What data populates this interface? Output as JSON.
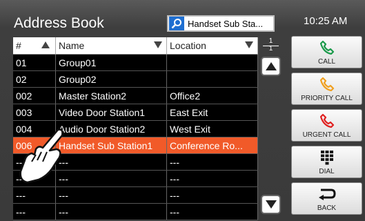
{
  "header": {
    "title": "Address Book",
    "search_value": "Handset Sub Sta...",
    "time": "10:25 AM"
  },
  "table": {
    "columns": [
      "#",
      "Name",
      "Location"
    ],
    "rows": [
      {
        "id": "01",
        "name": "Group01",
        "location": ""
      },
      {
        "id": "02",
        "name": "Group02",
        "location": ""
      },
      {
        "id": "002",
        "name": "Master Station2",
        "location": "Office2"
      },
      {
        "id": "003",
        "name": "Video Door Station1",
        "location": "East Exit"
      },
      {
        "id": "004",
        "name": "Audio Door Station2",
        "location": "West Exit"
      },
      {
        "id": "006",
        "name": "Handset Sub Station1",
        "location": "Conference Ro..."
      },
      {
        "id": "---",
        "name": "---",
        "location": "---"
      },
      {
        "id": "---",
        "name": "---",
        "location": "---"
      },
      {
        "id": "---",
        "name": "---",
        "location": "---"
      },
      {
        "id": "---",
        "name": "---",
        "location": "---"
      }
    ]
  },
  "pager": {
    "current": "1",
    "total": "1"
  },
  "buttons": {
    "call": "CALL",
    "priority_call": "PRIORITY CALL",
    "urgent_call": "URGENT CALL",
    "dial": "DIAL",
    "back": "BACK"
  },
  "colors": {
    "selected_row": "#f15a29",
    "call_icon": "#1a9a4a",
    "priority_icon": "#f0a020",
    "urgent_icon": "#e02020"
  }
}
